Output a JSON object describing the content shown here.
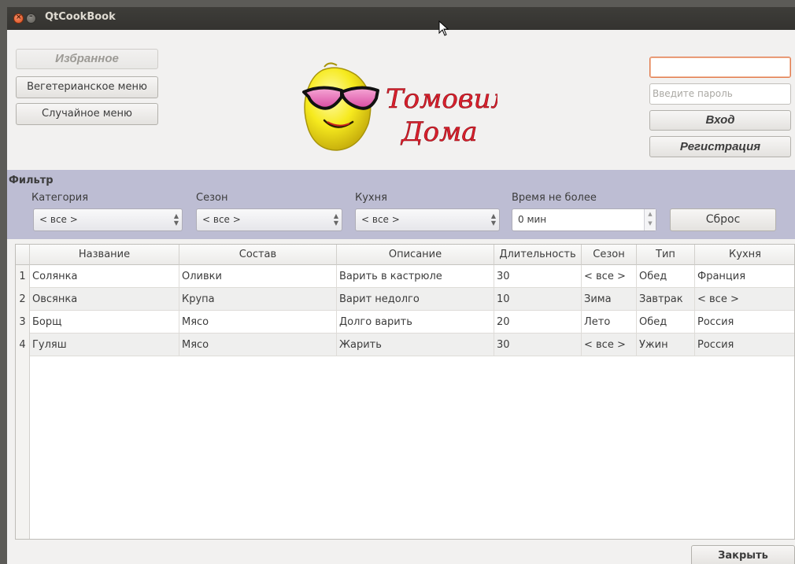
{
  "window": {
    "title": "QtCookBook"
  },
  "nav": {
    "favorites": "Избранное",
    "vegetarian": "Вегетерианское меню",
    "random": "Случайное меню"
  },
  "logo": {
    "line1": "Tомовим",
    "line2": "Дома"
  },
  "auth": {
    "login_value": "",
    "password_placeholder": "Введите пароль",
    "login_button": "Вход",
    "register_button": "Регистрация"
  },
  "filter": {
    "title": "Фильтр",
    "category_label": "Категория",
    "category_value": "< все >",
    "season_label": "Сезон",
    "season_value": "< все >",
    "cuisine_label": "Кухня",
    "cuisine_value": "< все >",
    "time_label": "Время не более",
    "time_value": "0 мин",
    "reset_button": "Сброс"
  },
  "table": {
    "columns": [
      "Название",
      "Состав",
      "Описание",
      "Длительность",
      "Сезон",
      "Тип",
      "Кухня"
    ],
    "rows": [
      {
        "num": "1",
        "cells": [
          "Солянка",
          "Оливки",
          "Варить в кастрюле",
          "30",
          "< все >",
          "Обед",
          "Франция"
        ]
      },
      {
        "num": "2",
        "cells": [
          "Овсянка",
          "Крупа",
          "Варит недолго",
          "10",
          "Зима",
          "Завтрак",
          "< все >"
        ]
      },
      {
        "num": "3",
        "cells": [
          "Борщ",
          "Мясо",
          "Долго варить",
          "20",
          "Лето",
          "Обед",
          "Россия"
        ]
      },
      {
        "num": "4",
        "cells": [
          "Гуляш",
          "Мясо",
          "Жарить",
          "30",
          "< все >",
          "Ужин",
          "Россия"
        ]
      }
    ]
  },
  "footer": {
    "close_button": "Закрыть"
  },
  "colors": {
    "filter_bg": "#bdbdd3",
    "logo_text": "#d9202d",
    "lemon": "#f3e61b",
    "titlebar": "#3c3b37"
  }
}
